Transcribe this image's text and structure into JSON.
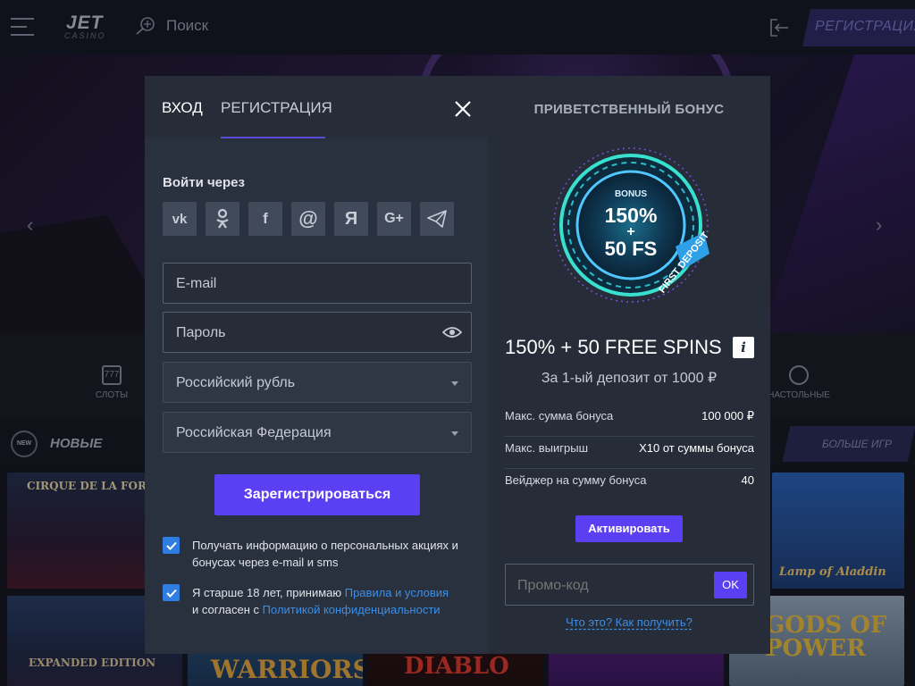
{
  "header": {
    "logo_main": "JET",
    "logo_sub": "CASINO",
    "search_label": "Поиск",
    "register_label": "РЕГИСТРАЦИЯ"
  },
  "categories": {
    "slots": "СЛОТЫ",
    "table": "НАСТОЛЬНЫЕ"
  },
  "new_section": {
    "badge": "NEW",
    "title": "НОВЫЕ",
    "more_games": "БОЛЬШЕ ИГР"
  },
  "tiles": {
    "t1": "CIRQUE DE LA FORTUNE",
    "t2": "WARRIORS",
    "t3": "DIABLO",
    "t4": "GODS OF POWER",
    "t5": "Lamp of Aladdin",
    "t6": "EXPANDED EDITION"
  },
  "modal": {
    "tab_login": "ВХОД",
    "tab_register": "РЕГИСТРАЦИЯ",
    "login_via": "Войти через",
    "socials": [
      "vk",
      "ok",
      "f",
      "@",
      "Я",
      "G+",
      "telegram"
    ],
    "email_placeholder": "E-mail",
    "password_placeholder": "Пароль",
    "currency": "Российский рубль",
    "country": "Российская Федерация",
    "register_button": "Зарегистрироваться",
    "consent_news": "Получать информацию о персональных акциях и бонусах через e-mail и sms",
    "consent_age_prefix": "Я старше 18 лет, принимаю ",
    "consent_age_link1": "Правила и условия",
    "consent_age_mid": "и согласен с ",
    "consent_age_link2": "Политикой конфиденциальности",
    "checkbox_color": "#2f7de0",
    "accent_color": "#5b3ff2"
  },
  "bonus": {
    "title": "ПРИВЕТСТВЕННЫЙ БОНУС",
    "badge_top": "BONUS",
    "badge_pct": "150%",
    "badge_plus": "+",
    "badge_fs": "50 FS",
    "badge_ribbon": "FIRST DEPOSIT",
    "offer": "150% + 50 FREE SPINS",
    "info": "i",
    "offer_sub": "За 1-ый депозит от 1000 ₽",
    "rows": [
      {
        "key": "Макс. сумма бонуса",
        "value": "100 000 ₽"
      },
      {
        "key": "Макс. выигрыш",
        "value": "Х10 от суммы бонуса"
      },
      {
        "key": "Вейджер на сумму бонуса",
        "value": "40"
      }
    ],
    "activate_button": "Активировать",
    "promo_placeholder": "Промо-код",
    "promo_ok": "OK",
    "promo_help": "Что это? Как получить?"
  }
}
